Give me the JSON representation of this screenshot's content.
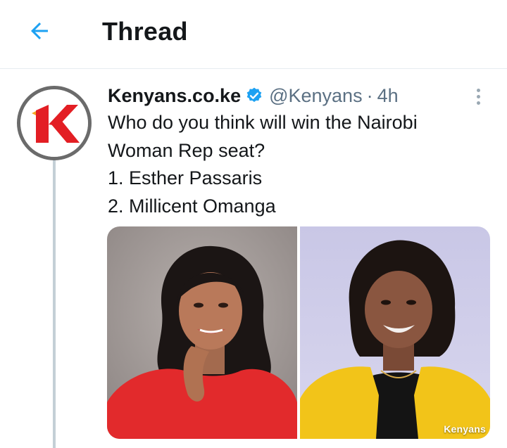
{
  "header": {
    "title": "Thread",
    "back_icon": "arrow-left-icon",
    "accent_color": "#1da1f2"
  },
  "tweet": {
    "author": {
      "display_name": "Kenyans.co.ke",
      "verified": true,
      "verified_icon": "verified-badge-icon",
      "handle": "@Kenyans",
      "separator": "·",
      "time": "4h",
      "avatar_logo_text": "K"
    },
    "more_icon": "more-vertical-icon",
    "text_lines": [
      "Who do you think will win the Nairobi",
      "Woman Rep seat?",
      "1. Esther Passaris",
      "2. Millicent Omanga"
    ],
    "media": {
      "photos": [
        {
          "subject": "woman-in-red-top-portrait"
        },
        {
          "subject": "woman-in-yellow-blazer-portrait"
        }
      ],
      "watermark": "Kenyans"
    }
  }
}
